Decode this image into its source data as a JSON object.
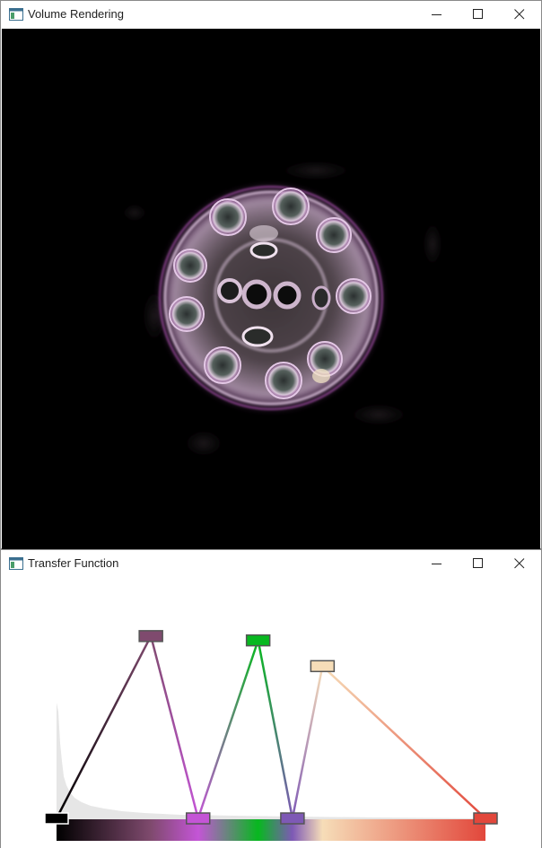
{
  "volume_window": {
    "title": "Volume Rendering",
    "controls": {
      "minimize_icon": "minimize-icon",
      "maximize_icon": "maximize-icon",
      "close_icon": "close-icon"
    }
  },
  "transfer_window": {
    "title": "Transfer Function",
    "controls": {
      "minimize_icon": "minimize-icon",
      "maximize_icon": "maximize-icon",
      "close_icon": "close-icon"
    },
    "control_points": [
      {
        "name": "cp-black",
        "color": "#000000",
        "value": 0.0,
        "opacity": 0.0
      },
      {
        "name": "cp-mauve",
        "color": "#7f4a6e",
        "value": 0.22,
        "opacity": 0.85
      },
      {
        "name": "cp-violet",
        "color": "#c455d6",
        "value": 0.33,
        "opacity": 0.0
      },
      {
        "name": "cp-green",
        "color": "#07b81f",
        "value": 0.47,
        "opacity": 0.83
      },
      {
        "name": "cp-purple",
        "color": "#7e59b5",
        "value": 0.55,
        "opacity": 0.0
      },
      {
        "name": "cp-beige",
        "color": "#f6ddb8",
        "value": 0.62,
        "opacity": 0.71
      },
      {
        "name": "cp-red",
        "color": "#e2473b",
        "value": 1.0,
        "opacity": 0.0
      }
    ]
  }
}
